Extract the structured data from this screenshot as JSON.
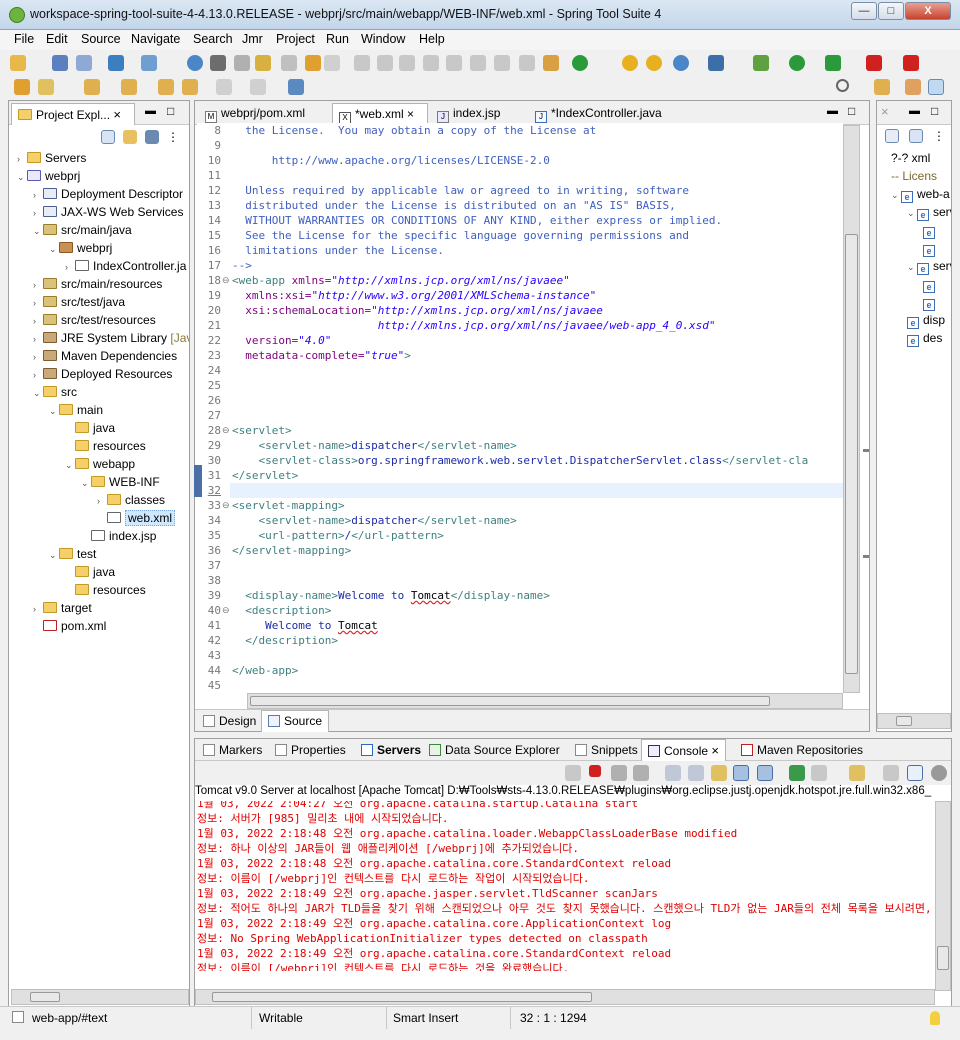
{
  "window": {
    "title": "workspace-spring-tool-suite-4-4.13.0.RELEASE - webprj/src/main/webapp/WEB-INF/web.xml - Spring Tool Suite 4",
    "minimize": "—",
    "maximize": "□",
    "close": "X"
  },
  "menu": [
    "File",
    "Edit",
    "Source",
    "Navigate",
    "Search",
    "Jmr",
    "Project",
    "Run",
    "Window",
    "Help"
  ],
  "explorer": {
    "title": "Project Expl...",
    "items": [
      {
        "label": "Servers",
        "depth": 0,
        "icon": "server",
        "tw": "›"
      },
      {
        "label": "webprj",
        "depth": 0,
        "icon": "proj",
        "tw": "⌄"
      },
      {
        "label": "Deployment Descriptor",
        "depth": 1,
        "icon": "dd",
        "tw": "›"
      },
      {
        "label": "JAX-WS Web Services",
        "depth": 1,
        "icon": "dd",
        "tw": "›"
      },
      {
        "label": "src/main/java",
        "depth": 1,
        "icon": "src",
        "tw": "⌄"
      },
      {
        "label": "webprj",
        "depth": 2,
        "icon": "pkg",
        "tw": "⌄"
      },
      {
        "label": "IndexController.ja",
        "depth": 3,
        "icon": "file",
        "tw": "›"
      },
      {
        "label": "src/main/resources",
        "depth": 1,
        "icon": "src",
        "tw": "›"
      },
      {
        "label": "src/test/java",
        "depth": 1,
        "icon": "src",
        "tw": "›"
      },
      {
        "label": "src/test/resources",
        "depth": 1,
        "icon": "src",
        "tw": "›"
      },
      {
        "label": "JRE System Library",
        "suffix": "[Jav",
        "depth": 1,
        "icon": "lib",
        "tw": "›"
      },
      {
        "label": "Maven Dependencies",
        "depth": 1,
        "icon": "lib",
        "tw": "›"
      },
      {
        "label": "Deployed Resources",
        "depth": 1,
        "icon": "lib",
        "tw": "›"
      },
      {
        "label": "src",
        "depth": 1,
        "icon": "folder",
        "tw": "⌄"
      },
      {
        "label": "main",
        "depth": 2,
        "icon": "folder",
        "tw": "⌄"
      },
      {
        "label": "java",
        "depth": 3,
        "icon": "folder",
        "tw": ""
      },
      {
        "label": "resources",
        "depth": 3,
        "icon": "folder",
        "tw": ""
      },
      {
        "label": "webapp",
        "depth": 3,
        "icon": "folder",
        "tw": "⌄"
      },
      {
        "label": "WEB-INF",
        "depth": 4,
        "icon": "folder",
        "tw": "⌄"
      },
      {
        "label": "classes",
        "depth": 5,
        "icon": "folder",
        "tw": "›"
      },
      {
        "label": "web.xml",
        "depth": 5,
        "icon": "file",
        "tw": "",
        "selected": true
      },
      {
        "label": "index.jsp",
        "depth": 4,
        "icon": "file",
        "tw": ""
      },
      {
        "label": "test",
        "depth": 2,
        "icon": "folder",
        "tw": "⌄"
      },
      {
        "label": "java",
        "depth": 3,
        "icon": "folder",
        "tw": ""
      },
      {
        "label": "resources",
        "depth": 3,
        "icon": "folder",
        "tw": ""
      },
      {
        "label": "target",
        "depth": 1,
        "icon": "folder",
        "tw": "›"
      },
      {
        "label": "pom.xml",
        "depth": 1,
        "icon": "mvn",
        "tw": ""
      }
    ]
  },
  "editor_tabs": [
    {
      "label": "webprj/pom.xml",
      "icon": "M"
    },
    {
      "label": "*web.xml",
      "icon": "X",
      "active": true,
      "close": "×"
    },
    {
      "label": "index.jsp",
      "icon": "J"
    },
    {
      "label": "*IndexController.java",
      "icon": "J"
    }
  ],
  "editor": {
    "lines": [
      {
        "n": "8",
        "segs": [
          [
            "cmt",
            "  the License.  You may obtain a copy of the License at"
          ]
        ]
      },
      {
        "n": "9",
        "segs": []
      },
      {
        "n": "10",
        "segs": [
          [
            "cmt",
            "      http://www.apache.org/licenses/LICENSE-2.0"
          ]
        ]
      },
      {
        "n": "11",
        "segs": []
      },
      {
        "n": "12",
        "segs": [
          [
            "cmt",
            "  Unless required by applicable law or agreed to in writing, software"
          ]
        ]
      },
      {
        "n": "13",
        "segs": [
          [
            "cmt",
            "  distributed under the License is distributed on an \"AS IS\" BASIS,"
          ]
        ]
      },
      {
        "n": "14",
        "segs": [
          [
            "cmt",
            "  WITHOUT WARRANTIES OR CONDITIONS OF ANY KIND, either express or implied."
          ]
        ]
      },
      {
        "n": "15",
        "segs": [
          [
            "cmt",
            "  See the License for the specific language governing permissions and"
          ]
        ]
      },
      {
        "n": "16",
        "segs": [
          [
            "cmt",
            "  limitations under the License."
          ]
        ]
      },
      {
        "n": "17",
        "segs": [
          [
            "cmt",
            "-->"
          ]
        ]
      },
      {
        "n": "18",
        "fold": "⊖",
        "segs": [
          [
            "tag",
            "<web-app "
          ],
          [
            "attr",
            "xmlns="
          ],
          [
            "val",
            "\"http://xmlns.jcp.org/xml/ns/javaee\""
          ]
        ]
      },
      {
        "n": "19",
        "segs": [
          [
            "attr",
            "  xmlns:xsi="
          ],
          [
            "val",
            "\"http://www.w3.org/2001/XMLSchema-instance\""
          ]
        ]
      },
      {
        "n": "20",
        "segs": [
          [
            "attr",
            "  xsi:schemaLocation="
          ],
          [
            "val",
            "\"http://xmlns.jcp.org/xml/ns/javaee"
          ]
        ]
      },
      {
        "n": "21",
        "segs": [
          [
            "val",
            "                      http://xmlns.jcp.org/xml/ns/javaee/web-app_4_0.xsd\""
          ]
        ]
      },
      {
        "n": "22",
        "segs": [
          [
            "attr",
            "  version="
          ],
          [
            "val",
            "\"4.0\""
          ]
        ]
      },
      {
        "n": "23",
        "segs": [
          [
            "attr",
            "  metadata-complete="
          ],
          [
            "val",
            "\"true\""
          ],
          [
            "tag",
            ">"
          ]
        ]
      },
      {
        "n": "24",
        "segs": []
      },
      {
        "n": "25",
        "segs": []
      },
      {
        "n": "26",
        "segs": []
      },
      {
        "n": "27",
        "segs": []
      },
      {
        "n": "28",
        "fold": "⊖",
        "segs": [
          [
            "tag",
            "<servlet>"
          ]
        ]
      },
      {
        "n": "29",
        "segs": [
          [
            "tag",
            "    <servlet-name>"
          ],
          [
            "con",
            "dispatcher"
          ],
          [
            "tag",
            "</servlet-name>"
          ]
        ]
      },
      {
        "n": "30",
        "segs": [
          [
            "tag",
            "    <servlet-class>"
          ],
          [
            "con",
            "org.springframework.web.servlet.DispatcherServlet.class"
          ],
          [
            "tag",
            "</servlet-cla"
          ]
        ]
      },
      {
        "n": "31",
        "segs": [
          [
            "tag",
            "</servlet>"
          ]
        ]
      },
      {
        "n": "32",
        "segs": [],
        "current": true
      },
      {
        "n": "33",
        "fold": "⊖",
        "segs": [
          [
            "tag",
            "<servlet-mapping>"
          ]
        ]
      },
      {
        "n": "34",
        "segs": [
          [
            "tag",
            "    <servlet-name>"
          ],
          [
            "con",
            "dispatcher"
          ],
          [
            "tag",
            "</servlet-name>"
          ]
        ]
      },
      {
        "n": "35",
        "segs": [
          [
            "tag",
            "    <url-pattern>"
          ],
          [
            "con",
            "/"
          ],
          [
            "tag",
            "</url-pattern>"
          ]
        ]
      },
      {
        "n": "36",
        "segs": [
          [
            "tag",
            "</servlet-mapping>"
          ]
        ]
      },
      {
        "n": "37",
        "segs": []
      },
      {
        "n": "38",
        "segs": []
      },
      {
        "n": "39",
        "segs": [
          [
            "tag",
            "  <display-name>"
          ],
          [
            "con",
            "Welcome to "
          ],
          [
            "sq",
            "Tomcat"
          ],
          [
            "tag",
            "</display-name>"
          ]
        ]
      },
      {
        "n": "40",
        "fold": "⊖",
        "segs": [
          [
            "tag",
            "  <description>"
          ]
        ]
      },
      {
        "n": "41",
        "segs": [
          [
            "con",
            "     Welcome to "
          ],
          [
            "sq",
            "Tomcat"
          ]
        ]
      },
      {
        "n": "42",
        "segs": [
          [
            "tag",
            "  </description>"
          ]
        ]
      },
      {
        "n": "43",
        "segs": []
      },
      {
        "n": "44",
        "segs": [
          [
            "tag",
            "</web-app>"
          ]
        ]
      },
      {
        "n": "45",
        "segs": []
      }
    ]
  },
  "editor_bottom_tabs": [
    "Design",
    "Source"
  ],
  "outline": {
    "items": [
      {
        "label": "?-? xml",
        "depth": 0
      },
      {
        "label": "-- Licens",
        "depth": 0,
        "comment": true
      },
      {
        "label": "web-a",
        "depth": 0,
        "e": true,
        "tw": "⌄"
      },
      {
        "label": "serv",
        "depth": 1,
        "e": true,
        "tw": "⌄"
      },
      {
        "label": "",
        "depth": 2,
        "e": true
      },
      {
        "label": "",
        "depth": 2,
        "e": true
      },
      {
        "label": "serv",
        "depth": 1,
        "e": true,
        "tw": "⌄"
      },
      {
        "label": "",
        "depth": 2,
        "e": true
      },
      {
        "label": "",
        "depth": 2,
        "e": true
      },
      {
        "label": "disp",
        "depth": 1,
        "e": true
      },
      {
        "label": "des",
        "depth": 1,
        "e": true
      }
    ]
  },
  "bottom_tabs": [
    "Markers",
    "Properties",
    "Servers",
    "Data Source Explorer",
    "Snippets",
    "Console",
    "Maven Repositories"
  ],
  "console": {
    "header": "Tomcat v9.0 Server at localhost [Apache Tomcat] D:₩Tools₩sts-4.13.0.RELEASE₩plugins₩org.eclipse.justj.openjdk.hotspot.jre.full.win32.x86_",
    "lines": [
      "1월 03, 2022 2:04:27 오전 org.apache.catalina.startup.Catalina start",
      "정보: 서버가 [985] 밀리초 내에 시작되었습니다.",
      "1월 03, 2022 2:18:48 오전 org.apache.catalina.loader.WebappClassLoaderBase modified",
      "정보: 하나 이상의 JAR들이 웹 애플리케이션 [/webprj]에 추가되었습니다.",
      "1월 03, 2022 2:18:48 오전 org.apache.catalina.core.StandardContext reload",
      "정보: 이름이 [/webprj]인 컨텍스트를 다시 로드하는 작업이 시작되었습니다.",
      "1월 03, 2022 2:18:49 오전 org.apache.jasper.servlet.TldScanner scanJars",
      "정보: 적어도 하나의 JAR가 TLD들을 찾기 위해 스캔되었으나 아무 것도 찾지 못했습니다. 스캔했으나 TLD가 없는 JAR들의 전체 목록을 보시려면, 로그 레벨",
      "1월 03, 2022 2:18:49 오전 org.apache.catalina.core.ApplicationContext log",
      "정보: No Spring WebApplicationInitializer types detected on classpath",
      "1월 03, 2022 2:18:49 오전 org.apache.catalina.core.StandardContext reload",
      "정보: 이름이 [/webprj]인 컨텍스트를 다시 로드하는 것을 완료했습니다."
    ]
  },
  "status": {
    "path": "web-app/#text",
    "writable": "Writable",
    "insert": "Smart Insert",
    "position": "32 : 1 : 1294"
  }
}
